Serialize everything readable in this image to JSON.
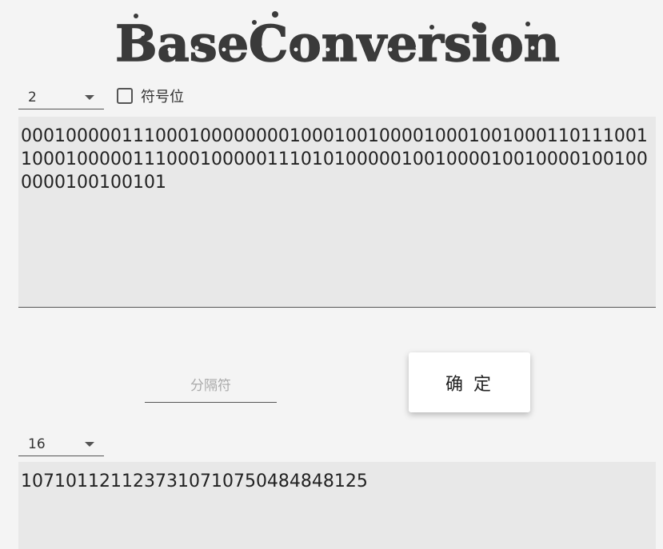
{
  "header": {
    "logo_text": "BaseConversion"
  },
  "input": {
    "base_value": "2",
    "sign_bit_label": "符号位",
    "sign_bit_checked": false,
    "value": "000100000111000100000000100010010000100010010001101110011000100000111000100000111010100000100100001001000010010000001001001 01"
  },
  "separator": {
    "placeholder": "分隔符",
    "value": ""
  },
  "confirm_label": "确 定",
  "output": {
    "base_value": "16",
    "value": "10710112112373107107504848481​25"
  },
  "colors": {
    "background": "#f4f4f4",
    "textarea_bg": "#e8e8e8",
    "text": "#333333",
    "underline": "#555555"
  }
}
